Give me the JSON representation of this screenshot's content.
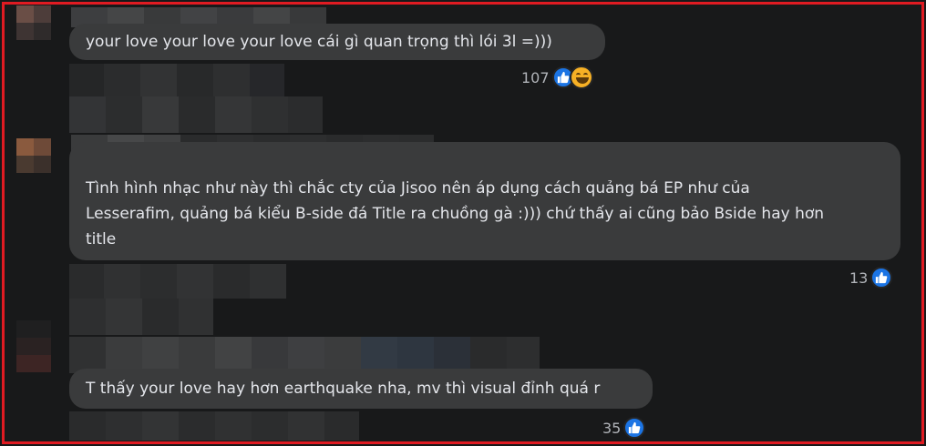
{
  "comments": [
    {
      "text_lines": [
        "your love your love your love cái gì quan trọng thì lói 3l =)))"
      ],
      "reaction_count": "107",
      "reactions": [
        "like-icon",
        "haha-icon"
      ]
    },
    {
      "text_lines": [
        "Tình hình nhạc như này thì chắc cty của Jisoo nên áp dụng cách quảng bá EP như của",
        "Lesserafim, quảng bá kiểu B-side đá Title ra chuồng gà :))) chứ thấy ai cũng bảo Bside hay hơn",
        "title"
      ],
      "reaction_count": "13",
      "reactions": [
        "like-icon"
      ]
    },
    {
      "text_lines": [
        "T thấy your love hay hơn earthquake nha, mv thì visual đỉnh quá r"
      ],
      "reaction_count": "35",
      "reactions": [
        "like-icon"
      ]
    }
  ],
  "colors": {
    "background": "#18191a",
    "bubble": "#3a3b3c",
    "text": "#e4e6eb",
    "meta": "#b0b3b8",
    "like": "#1b74e4",
    "haha": "#f7b125",
    "frame": "#e01b22"
  }
}
